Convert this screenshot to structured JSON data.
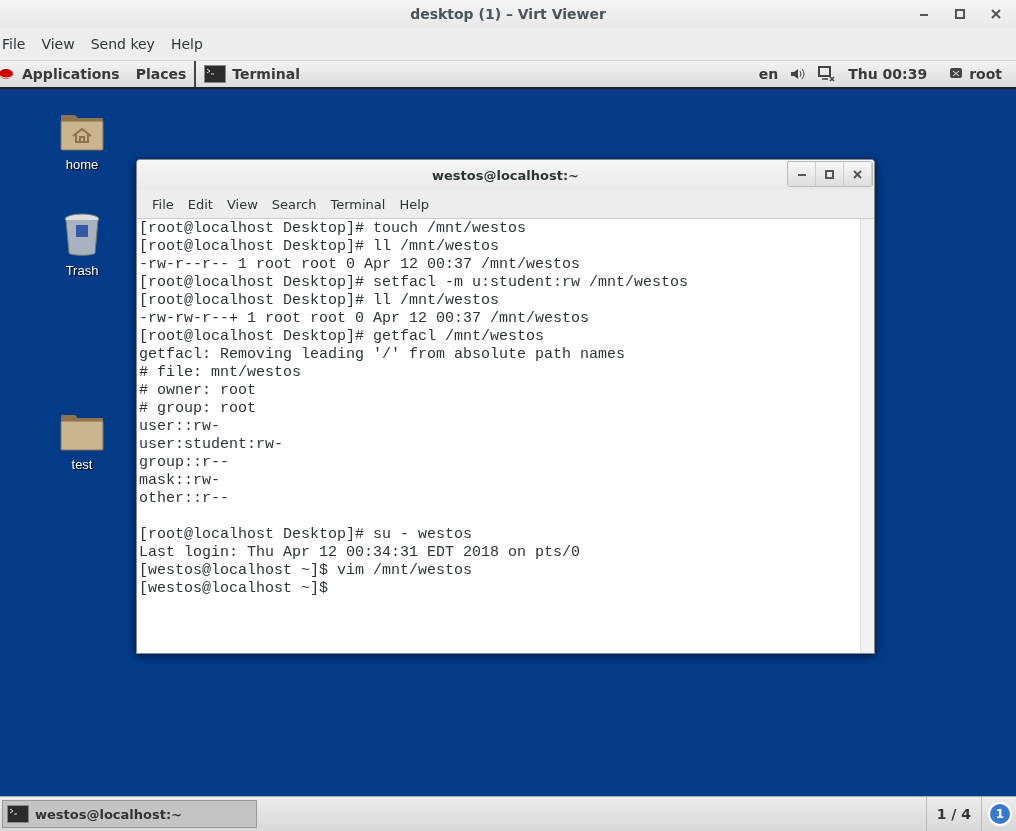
{
  "window": {
    "title": "desktop (1) – Virt Viewer"
  },
  "menu": [
    "File",
    "View",
    "Send key",
    "Help"
  ],
  "top_bar": {
    "applications": "Applications",
    "places": "Places",
    "app": "Terminal",
    "language": "en",
    "clock": "Thu 00:39",
    "user": "root"
  },
  "desktop_icons": [
    {
      "kind": "home",
      "label": "home"
    },
    {
      "kind": "trash",
      "label": "Trash"
    },
    {
      "kind": "folder",
      "label": "test"
    }
  ],
  "terminal": {
    "title": "westos@localhost:~",
    "menu": [
      "File",
      "Edit",
      "View",
      "Search",
      "Terminal",
      "Help"
    ],
    "lines": [
      "[root@localhost Desktop]# touch /mnt/westos",
      "[root@localhost Desktop]# ll /mnt/westos",
      "-rw-r--r-- 1 root root 0 Apr 12 00:37 /mnt/westos",
      "[root@localhost Desktop]# setfacl -m u:student:rw /mnt/westos",
      "[root@localhost Desktop]# ll /mnt/westos",
      "-rw-rw-r--+ 1 root root 0 Apr 12 00:37 /mnt/westos",
      "[root@localhost Desktop]# getfacl /mnt/westos",
      "getfacl: Removing leading '/' from absolute path names",
      "# file: mnt/westos",
      "# owner: root",
      "# group: root",
      "user::rw-",
      "user:student:rw-",
      "group::r--",
      "mask::rw-",
      "other::r--",
      {
        "kind": "blank"
      },
      "[root@localhost Desktop]# su - westos",
      "Last login: Thu Apr 12 00:34:31 EDT 2018 on pts/0",
      "[westos@localhost ~]$ vim /mnt/westos",
      "[westos@localhost ~]$"
    ]
  },
  "taskbar": {
    "items": [
      "westos@localhost:~"
    ],
    "workspace": "1 / 4",
    "notifications": "1"
  }
}
